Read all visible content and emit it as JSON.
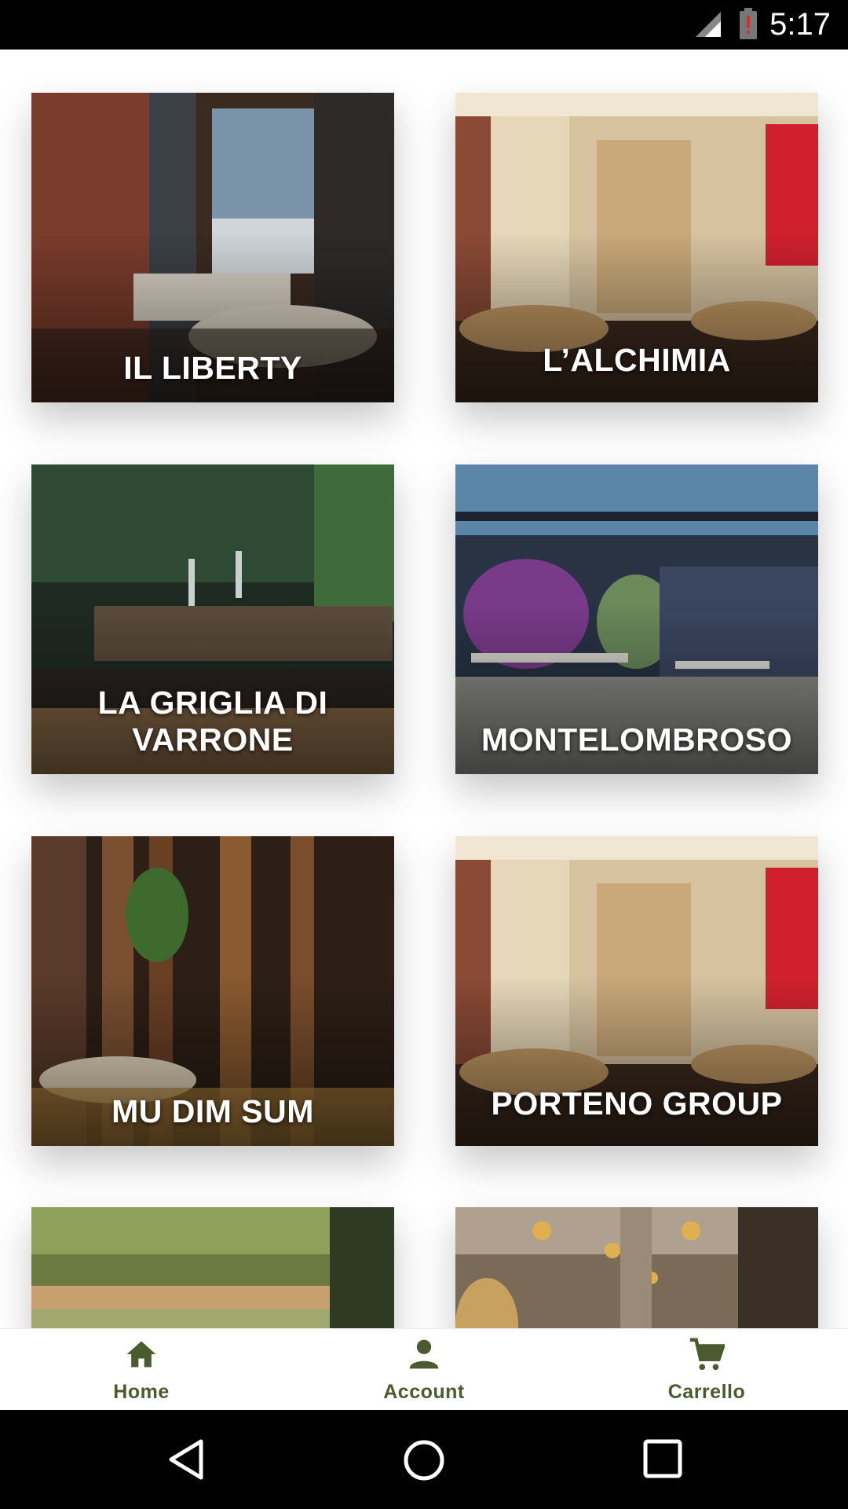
{
  "status_bar": {
    "time": "5:17",
    "icons": [
      "signal-icon",
      "battery-alert-icon"
    ]
  },
  "restaurants": [
    {
      "name": "IL LIBERTY"
    },
    {
      "name": "L’ALCHIMIA"
    },
    {
      "name": "LA GRIGLIA DI VARRONE"
    },
    {
      "name": "MONTELOMBROSO"
    },
    {
      "name": "MU DIM SUM"
    },
    {
      "name": "PORTENO GROUP"
    },
    {
      "name": ""
    },
    {
      "name": ""
    }
  ],
  "bottom_nav": {
    "items": [
      {
        "label": "Home",
        "icon": "home-icon"
      },
      {
        "label": "Account",
        "icon": "person-icon"
      },
      {
        "label": "Carrello",
        "icon": "cart-icon"
      }
    ],
    "color": "#4b5a2f"
  },
  "system_nav": {
    "icons": [
      "back-icon",
      "home-circle-icon",
      "recents-icon"
    ]
  }
}
